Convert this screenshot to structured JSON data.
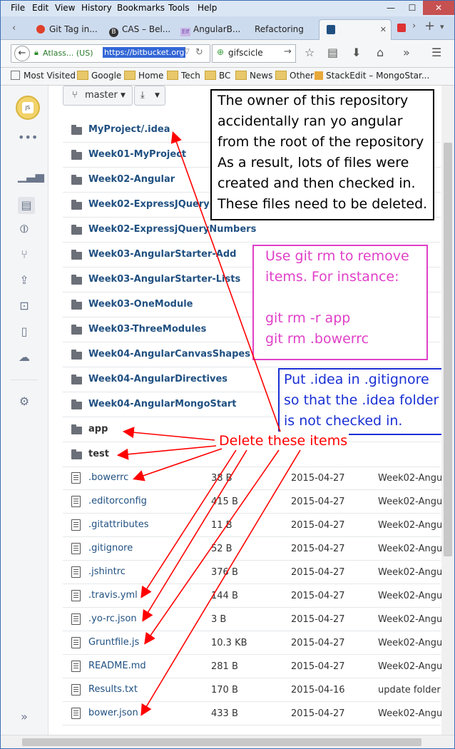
{
  "menu": [
    "File",
    "Edit",
    "View",
    "History",
    "Bookmarks",
    "Tools",
    "Help"
  ],
  "window_buttons": {
    "minimize": "—",
    "maximize": "☐",
    "close": "✕"
  },
  "tabs": [
    {
      "label": "Git Tag in..."
    },
    {
      "label": "CAS – Bel..."
    },
    {
      "label": "AngularB..."
    },
    {
      "label": "Refactoring"
    }
  ],
  "url": {
    "identity": "Atlass... (US)",
    "value": "https://bitbucket.org"
  },
  "search": {
    "value": "gifscicle"
  },
  "bookmarks": [
    "Most Visited",
    "Google",
    "Home",
    "Tech",
    "BC",
    "News",
    "Other",
    "StackEdit – MongoStar..."
  ],
  "toolbar": {
    "branch": "master",
    "download": "⤓"
  },
  "folders": [
    "MyProject/.idea",
    "Week01-MyProject",
    "Week02-Angular",
    "Week02-ExpressJQuery",
    "Week02-ExpressjQueryNumbers",
    "Week03-AngularStarter-Add",
    "Week03-AngularStarter-Lists",
    "Week03-OneModule",
    "Week03-ThreeModules",
    "Week04-AngularCanvasShapes",
    "Week04-AngularDirectives",
    "Week04-AngularMongoStart",
    "app",
    "test"
  ],
  "files": [
    {
      "name": ".bowerrc",
      "size": "38 B",
      "date": "2015-04-27",
      "msg": "Week02-Angu"
    },
    {
      "name": ".editorconfig",
      "size": "415 B",
      "date": "2015-04-27",
      "msg": "Week02-Angu"
    },
    {
      "name": ".gitattributes",
      "size": "11 B",
      "date": "2015-04-27",
      "msg": "Week02-Angu"
    },
    {
      "name": ".gitignore",
      "size": "52 B",
      "date": "2015-04-27",
      "msg": "Week02-Angu"
    },
    {
      "name": ".jshintrc",
      "size": "376 B",
      "date": "2015-04-27",
      "msg": "Week02-Angu"
    },
    {
      "name": ".travis.yml",
      "size": "144 B",
      "date": "2015-04-27",
      "msg": "Week02-Angu"
    },
    {
      "name": ".yo-rc.json",
      "size": "3 B",
      "date": "2015-04-27",
      "msg": "Week02-Angu"
    },
    {
      "name": "Gruntfile.js",
      "size": "10.3 KB",
      "date": "2015-04-27",
      "msg": "Week02-Angu"
    },
    {
      "name": "README.md",
      "size": "281 B",
      "date": "2015-04-27",
      "msg": "Week02-Angu"
    },
    {
      "name": "Results.txt",
      "size": "170 B",
      "date": "2015-04-16",
      "msg": "update folder"
    },
    {
      "name": "bower.json",
      "size": "433 B",
      "date": "2015-04-27",
      "msg": "Week02-Angu"
    }
  ],
  "annotations": {
    "owner": [
      "The owner of this repository",
      "accidentally ran yo angular",
      "from the root of the repository",
      "As a result, lots of files were",
      "created and then checked in.",
      "These files need to be deleted."
    ],
    "gitrm": [
      "Use git rm to remove",
      "items. For instance:",
      "",
      "git rm -r app",
      "git rm .bowerrc"
    ],
    "gitignore": [
      "Put .idea in .gitignore",
      "so that the .idea folder",
      "is not checked in."
    ],
    "delete": "Delete these items"
  },
  "colors": {
    "link": "#205081",
    "annotation_red": "#ff0000",
    "annotation_magenta": "#e040c8",
    "annotation_blue": "#1a2fd4"
  }
}
